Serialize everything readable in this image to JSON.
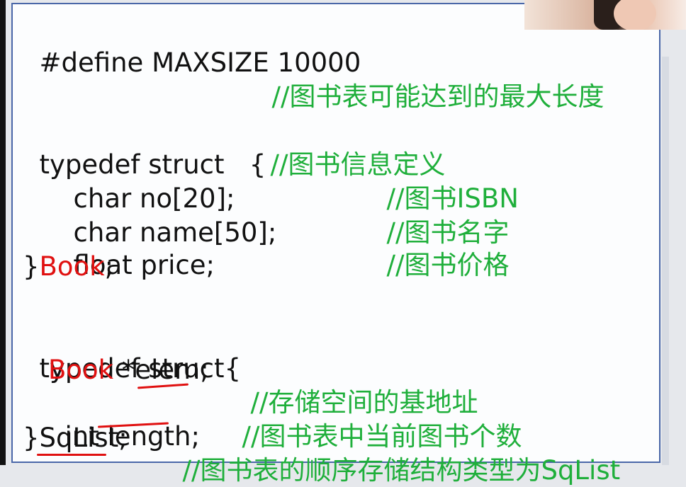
{
  "code": {
    "define_stmt": "#define MAXSIZE 10000",
    "define_comment": "//图书表可能达到的最大长度",
    "typedef1_open": "typedef struct   {",
    "typedef1_comment": "//图书信息定义",
    "field_no": "char no[20];",
    "field_no_comment": "//图书ISBN",
    "field_name": "char name[50];",
    "field_name_comment": "//图书名字",
    "field_price": "float price;",
    "field_price_comment": "//图书价格",
    "close1_brace": "}",
    "close1_type": "Book",
    "close1_semi": ";",
    "typedef2_open": "typedef struct{",
    "elem_type": "Book",
    "elem_rest": " *elem;",
    "elem_comment": "//存储空间的基地址",
    "length_field": "int length;",
    "length_comment": "//图书表中当前图书个数",
    "close2_brace": "}",
    "close2_type": "SqList;",
    "close2_comment": "//图书表的顺序存储结构类型为SqList"
  },
  "colors": {
    "comment": "#1faf3b",
    "highlight": "#e01010",
    "panel_border": "#4a67a8",
    "text": "#111111"
  }
}
